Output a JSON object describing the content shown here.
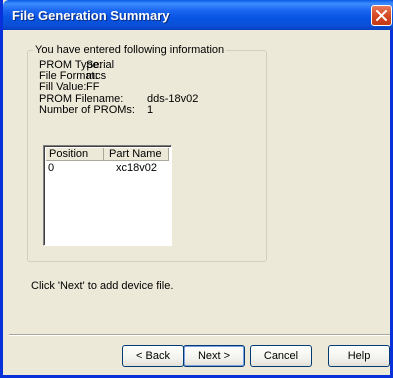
{
  "window": {
    "title": "File Generation Summary"
  },
  "summary": {
    "legend": "You have entered following information",
    "rows": [
      {
        "label": "PROM Type:",
        "value": "Serial"
      },
      {
        "label": "File Format:",
        "value": "mcs"
      },
      {
        "label": "Fill Value:",
        "value": "FF"
      },
      {
        "label": "PROM Filename:",
        "value": "dds-18v02"
      },
      {
        "label": "Number of PROMs:",
        "value": "1"
      }
    ]
  },
  "table": {
    "columns": [
      "Position",
      "Part Name"
    ],
    "rows": [
      {
        "position": "0",
        "part_name": "xc18v02"
      }
    ]
  },
  "hint": "Click 'Next' to add device file.",
  "buttons": {
    "back": "< Back",
    "next": "Next >",
    "cancel": "Cancel",
    "help": "Help"
  }
}
